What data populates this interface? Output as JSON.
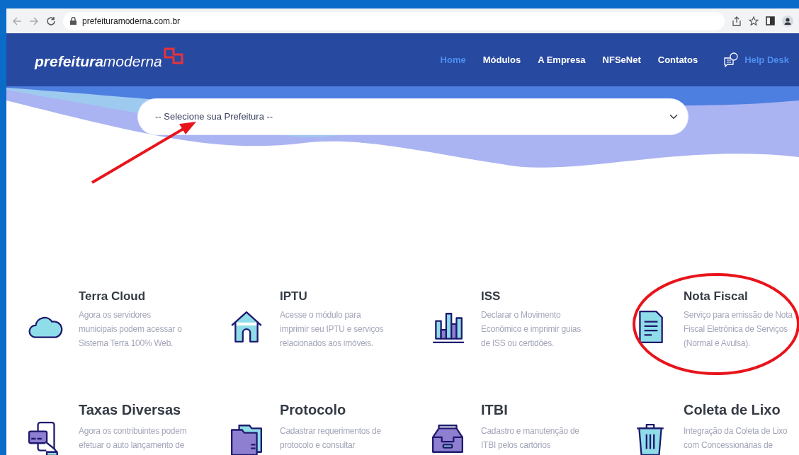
{
  "browser": {
    "url": "prefeituramoderna.com.br"
  },
  "brand": {
    "bold": "prefeitura",
    "light": "moderna"
  },
  "nav": [
    {
      "label": "Home",
      "selected": true
    },
    {
      "label": "Módulos",
      "selected": false
    },
    {
      "label": "A Empresa",
      "selected": false
    },
    {
      "label": "NFSeNet",
      "selected": false
    },
    {
      "label": "Contatos",
      "selected": false
    }
  ],
  "help_desk": {
    "label": "Help Desk"
  },
  "select": {
    "value": "-- Selecione sua Prefeitura --"
  },
  "service_rows": [
    [
      {
        "title": "Terra Cloud",
        "lines": [
          "Agora os servidores",
          "municipais podem acessar o",
          "Sistema Terra 100% Web."
        ]
      },
      {
        "title": "IPTU",
        "lines": [
          "Acesse o módulo para",
          "imprimir seu IPTU e serviços",
          "relacionados aos imóveis."
        ]
      },
      {
        "title": "ISS",
        "lines": [
          "Declarar o Movimento",
          "Econômico e imprimir guias",
          "de ISS ou certidões."
        ]
      },
      {
        "title": "Nota Fiscal",
        "lines": [
          "Serviço para emissão de Nota",
          "Fiscal Eletrônica de Serviços",
          "(Normal e Avulsa)."
        ]
      }
    ],
    [
      {
        "title": "Taxas Diversas",
        "lines": [
          "Agora os contribuintes podem",
          "efetuar o auto lançamento de"
        ]
      },
      {
        "title": "Protocolo",
        "lines": [
          "Cadastrar requerimentos de",
          "protocolo e consultar"
        ]
      },
      {
        "title": "ITBI",
        "lines": [
          "Cadastro e manutenção de",
          "ITBI pelos cartórios"
        ]
      },
      {
        "title": "Coleta de Lixo",
        "lines": [
          "Integração da Coleta de Lixo",
          "com Concessionárias de"
        ]
      }
    ]
  ]
}
